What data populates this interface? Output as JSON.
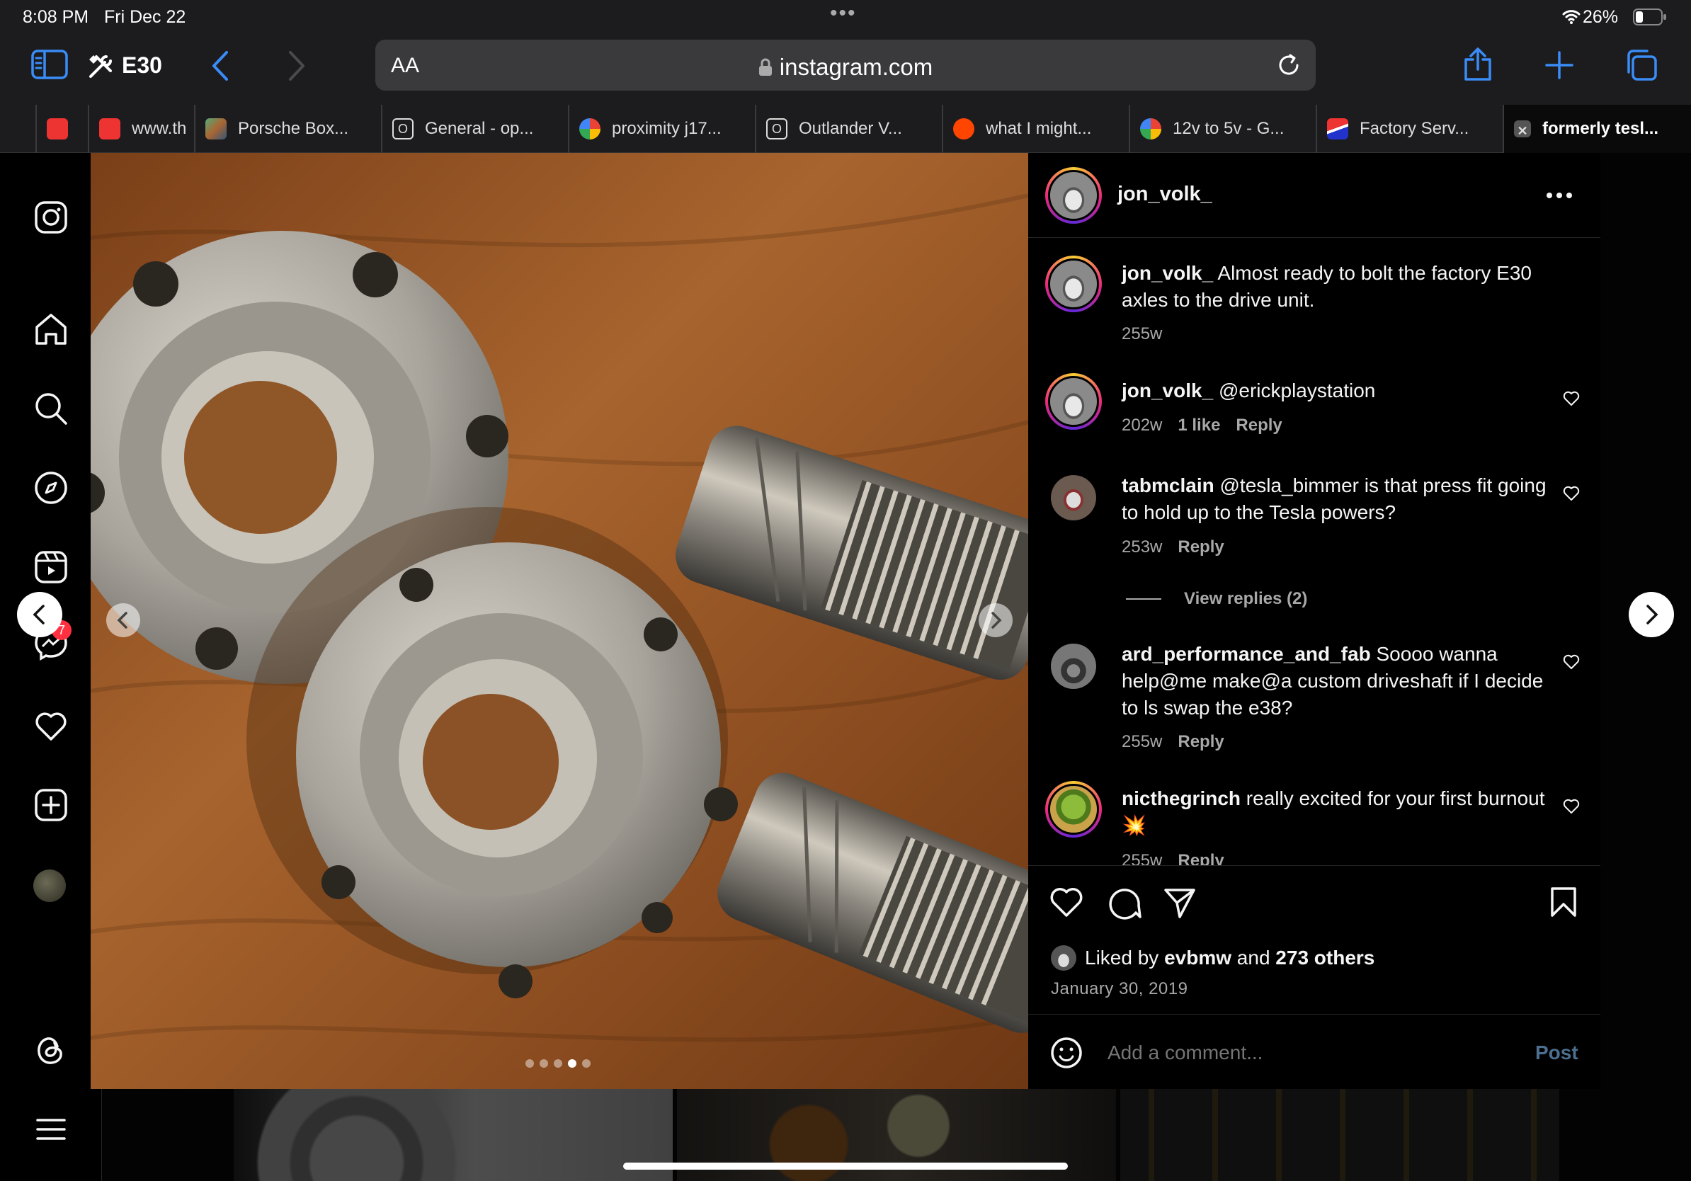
{
  "status_bar": {
    "time": "8:08 PM",
    "date": "Fri Dec 22",
    "battery": "26%"
  },
  "toolbar": {
    "tab_group": "E30",
    "url_aa": "AA",
    "url_host": "instagram.com"
  },
  "tabs": [
    {
      "label": "",
      "favicon": "red-site"
    },
    {
      "label": "www.th",
      "favicon": "red-site"
    },
    {
      "label": "Porsche Box...",
      "favicon": "image-site"
    },
    {
      "label": "General - op...",
      "favicon": "o-box"
    },
    {
      "label": "proximity j17...",
      "favicon": "google"
    },
    {
      "label": "Outlander V...",
      "favicon": "o-box"
    },
    {
      "label": "what I might...",
      "favicon": "reddit"
    },
    {
      "label": "12v to 5v - G...",
      "favicon": "google"
    },
    {
      "label": "Factory Serv...",
      "favicon": "flag-site"
    },
    {
      "label": "formerly tesl...",
      "favicon": "close-x"
    }
  ],
  "sidebar": {
    "messages_badge": "7"
  },
  "post": {
    "author": "jon_volk_",
    "carousel_count": 5,
    "carousel_active": 3,
    "caption": {
      "user": "jon_volk_",
      "text": "Almost ready to bolt the factory E30 axles to the drive unit.",
      "age": "255w"
    },
    "comments": [
      {
        "user": "jon_volk_",
        "text": "@erickplaystation",
        "age": "202w",
        "likes": "1 like",
        "reply": "Reply"
      },
      {
        "user": "tabmclain",
        "text": "@tesla_bimmer is that press fit going to hold up to the Tesla powers?",
        "age": "253w",
        "reply": "Reply",
        "view_replies": "View replies (2)"
      },
      {
        "user": "ard_performance_and_fab",
        "text": "Soooo wanna help@me make@a custom driveshaft if I decide to ls swap the e38?",
        "age": "255w",
        "reply": "Reply"
      },
      {
        "user": "nicthegrinch",
        "text": "really excited for your first burnout💥",
        "age": "255w",
        "reply": "Reply"
      }
    ],
    "liked_by_prefix": "Liked by",
    "liked_by_user": "evbmw",
    "liked_by_and": "and",
    "liked_by_others": "273 others",
    "date": "January 30, 2019",
    "comment_placeholder": "Add a comment...",
    "post_button": "Post"
  },
  "colors": {
    "accent": "#3a8cf7",
    "link": "#4d6f8f",
    "photo_wood": "#8a4e22"
  }
}
